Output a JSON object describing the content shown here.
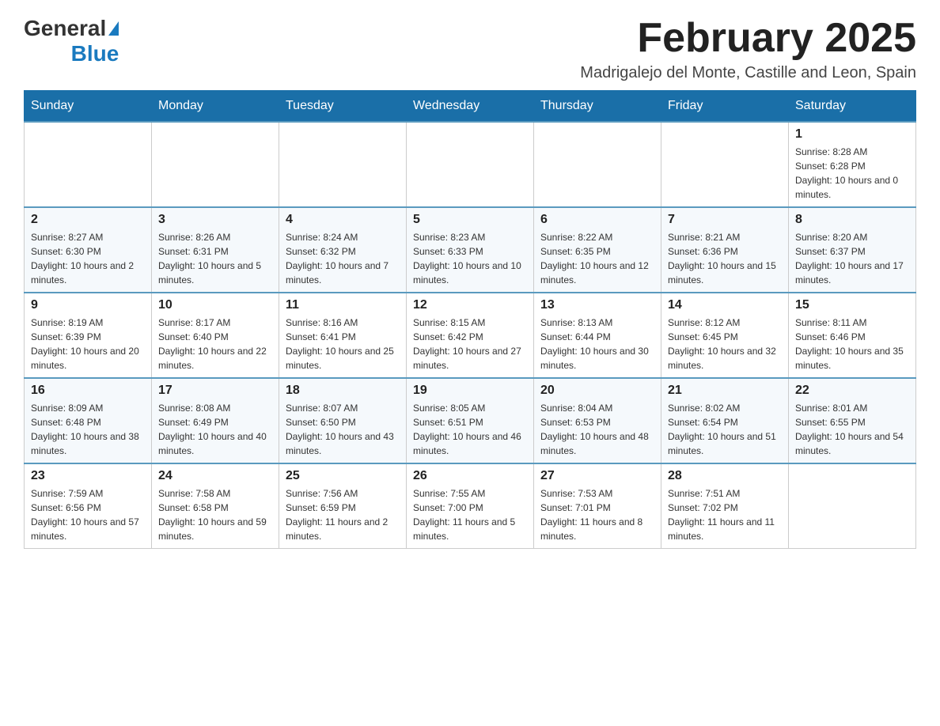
{
  "logo": {
    "general": "General",
    "blue": "Blue"
  },
  "header": {
    "title": "February 2025",
    "subtitle": "Madrigalejo del Monte, Castille and Leon, Spain"
  },
  "weekdays": [
    "Sunday",
    "Monday",
    "Tuesday",
    "Wednesday",
    "Thursday",
    "Friday",
    "Saturday"
  ],
  "weeks": [
    [
      {
        "day": "",
        "info": ""
      },
      {
        "day": "",
        "info": ""
      },
      {
        "day": "",
        "info": ""
      },
      {
        "day": "",
        "info": ""
      },
      {
        "day": "",
        "info": ""
      },
      {
        "day": "",
        "info": ""
      },
      {
        "day": "1",
        "info": "Sunrise: 8:28 AM\nSunset: 6:28 PM\nDaylight: 10 hours and 0 minutes."
      }
    ],
    [
      {
        "day": "2",
        "info": "Sunrise: 8:27 AM\nSunset: 6:30 PM\nDaylight: 10 hours and 2 minutes."
      },
      {
        "day": "3",
        "info": "Sunrise: 8:26 AM\nSunset: 6:31 PM\nDaylight: 10 hours and 5 minutes."
      },
      {
        "day": "4",
        "info": "Sunrise: 8:24 AM\nSunset: 6:32 PM\nDaylight: 10 hours and 7 minutes."
      },
      {
        "day": "5",
        "info": "Sunrise: 8:23 AM\nSunset: 6:33 PM\nDaylight: 10 hours and 10 minutes."
      },
      {
        "day": "6",
        "info": "Sunrise: 8:22 AM\nSunset: 6:35 PM\nDaylight: 10 hours and 12 minutes."
      },
      {
        "day": "7",
        "info": "Sunrise: 8:21 AM\nSunset: 6:36 PM\nDaylight: 10 hours and 15 minutes."
      },
      {
        "day": "8",
        "info": "Sunrise: 8:20 AM\nSunset: 6:37 PM\nDaylight: 10 hours and 17 minutes."
      }
    ],
    [
      {
        "day": "9",
        "info": "Sunrise: 8:19 AM\nSunset: 6:39 PM\nDaylight: 10 hours and 20 minutes."
      },
      {
        "day": "10",
        "info": "Sunrise: 8:17 AM\nSunset: 6:40 PM\nDaylight: 10 hours and 22 minutes."
      },
      {
        "day": "11",
        "info": "Sunrise: 8:16 AM\nSunset: 6:41 PM\nDaylight: 10 hours and 25 minutes."
      },
      {
        "day": "12",
        "info": "Sunrise: 8:15 AM\nSunset: 6:42 PM\nDaylight: 10 hours and 27 minutes."
      },
      {
        "day": "13",
        "info": "Sunrise: 8:13 AM\nSunset: 6:44 PM\nDaylight: 10 hours and 30 minutes."
      },
      {
        "day": "14",
        "info": "Sunrise: 8:12 AM\nSunset: 6:45 PM\nDaylight: 10 hours and 32 minutes."
      },
      {
        "day": "15",
        "info": "Sunrise: 8:11 AM\nSunset: 6:46 PM\nDaylight: 10 hours and 35 minutes."
      }
    ],
    [
      {
        "day": "16",
        "info": "Sunrise: 8:09 AM\nSunset: 6:48 PM\nDaylight: 10 hours and 38 minutes."
      },
      {
        "day": "17",
        "info": "Sunrise: 8:08 AM\nSunset: 6:49 PM\nDaylight: 10 hours and 40 minutes."
      },
      {
        "day": "18",
        "info": "Sunrise: 8:07 AM\nSunset: 6:50 PM\nDaylight: 10 hours and 43 minutes."
      },
      {
        "day": "19",
        "info": "Sunrise: 8:05 AM\nSunset: 6:51 PM\nDaylight: 10 hours and 46 minutes."
      },
      {
        "day": "20",
        "info": "Sunrise: 8:04 AM\nSunset: 6:53 PM\nDaylight: 10 hours and 48 minutes."
      },
      {
        "day": "21",
        "info": "Sunrise: 8:02 AM\nSunset: 6:54 PM\nDaylight: 10 hours and 51 minutes."
      },
      {
        "day": "22",
        "info": "Sunrise: 8:01 AM\nSunset: 6:55 PM\nDaylight: 10 hours and 54 minutes."
      }
    ],
    [
      {
        "day": "23",
        "info": "Sunrise: 7:59 AM\nSunset: 6:56 PM\nDaylight: 10 hours and 57 minutes."
      },
      {
        "day": "24",
        "info": "Sunrise: 7:58 AM\nSunset: 6:58 PM\nDaylight: 10 hours and 59 minutes."
      },
      {
        "day": "25",
        "info": "Sunrise: 7:56 AM\nSunset: 6:59 PM\nDaylight: 11 hours and 2 minutes."
      },
      {
        "day": "26",
        "info": "Sunrise: 7:55 AM\nSunset: 7:00 PM\nDaylight: 11 hours and 5 minutes."
      },
      {
        "day": "27",
        "info": "Sunrise: 7:53 AM\nSunset: 7:01 PM\nDaylight: 11 hours and 8 minutes."
      },
      {
        "day": "28",
        "info": "Sunrise: 7:51 AM\nSunset: 7:02 PM\nDaylight: 11 hours and 11 minutes."
      },
      {
        "day": "",
        "info": ""
      }
    ]
  ]
}
